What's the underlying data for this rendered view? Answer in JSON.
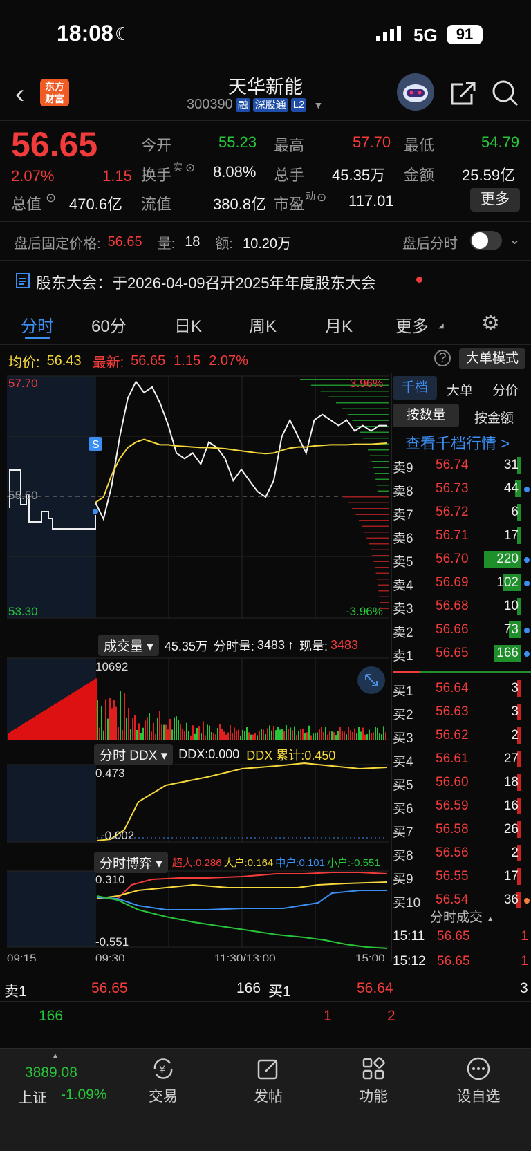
{
  "status_bar": {
    "time": "18:08",
    "network": "5G",
    "battery": "91"
  },
  "header": {
    "brand_line1": "东方",
    "brand_line2": "财富",
    "stock_name": "天华新能",
    "stock_code": "300390",
    "tags": [
      "融",
      "深股通",
      "L2"
    ]
  },
  "quote": {
    "price": "56.65",
    "change_pct": "2.07%",
    "change": "1.15",
    "open_label": "今开",
    "open": "55.23",
    "high_label": "最高",
    "high": "57.70",
    "low_label": "最低",
    "low": "54.79",
    "turnover_label": "换手",
    "turnover_sup": "实",
    "turnover": "8.08%",
    "volume_label": "总手",
    "volume": "45.35万",
    "amount_label": "金额",
    "amount": "25.59亿",
    "mcap_label": "总值",
    "mcap": "470.6亿",
    "float_label": "流值",
    "float": "380.8亿",
    "pe_label": "市盈",
    "pe_sup": "动",
    "pe": "117.01",
    "more_button": "更多"
  },
  "after_hours": {
    "label": "盘后固定价格:",
    "price": "56.65",
    "qty_label": "量:",
    "qty": "18",
    "amt_label": "额:",
    "amt": "10.20万",
    "toggle_label": "盘后分时"
  },
  "notice": {
    "text": "股东大会：于2026-04-09召开2025年年度股东大会"
  },
  "tabs": {
    "t1": "分时",
    "t2": "60分",
    "t3": "日K",
    "t4": "周K",
    "t5": "月K",
    "t6": "更多"
  },
  "info_line": {
    "avg_label": "均价:",
    "avg": "56.43",
    "latest_label": "最新:",
    "latest": "56.65",
    "change": "1.15",
    "pct": "2.07%",
    "mode_button": "大单模式"
  },
  "chart_data": {
    "type": "line",
    "title": "",
    "y_max_label": "57.70",
    "y_mid_label": "55.50",
    "y_min_label": "53.30",
    "pct_max_label": "3.96%",
    "pct_min_label": "-3.96%",
    "ylim": [
      53.3,
      57.7
    ],
    "prev_close": 55.5,
    "x_ticks": [
      "09:15",
      "09:30",
      "11:30/13:00",
      "15:00"
    ],
    "series": [
      {
        "values": [
          55.4,
          55.1,
          55.7,
          56.6,
          57.3,
          57.6,
          57.4,
          57.5,
          57.2,
          56.8,
          56.3,
          56.2,
          56.3,
          56.1,
          56.5,
          56.4,
          56.2,
          55.8,
          56.0,
          55.8,
          55.6,
          55.5,
          55.8,
          56.6,
          56.9,
          56.6,
          56.3,
          56.9,
          57.0,
          56.9,
          56.8,
          56.9,
          56.7,
          56.8,
          56.7,
          56.8,
          56.8
        ]
      },
      {
        "values": [
          55.4,
          55.5,
          55.9,
          56.2,
          56.4,
          56.5,
          56.55,
          56.5,
          56.45,
          56.45,
          56.43,
          56.42,
          56.41,
          56.4,
          56.4,
          56.39,
          56.38,
          56.36,
          56.34,
          56.32,
          56.3,
          56.29,
          56.3,
          56.35,
          56.39,
          56.41,
          56.41,
          56.43,
          56.44,
          56.45,
          56.45,
          56.45,
          56.46,
          56.46,
          56.46,
          56.47,
          56.48
        ]
      }
    ]
  },
  "volume_panel": {
    "label": "成交量",
    "total": "45.35万",
    "minute_label": "分时量:",
    "minute": "3483",
    "now_label": "现量:",
    "now": "3483",
    "max": "10692"
  },
  "ddx_panel": {
    "label": "分时 DDX",
    "ddx": "DDX:0.000",
    "ddx_cum": "DDX 累计:0.450",
    "max": "0.473",
    "min": "-0.002"
  },
  "game_panel": {
    "label": "分时博弈",
    "super": "超大:0.286",
    "big": "大户:0.164",
    "mid": "中户:0.101",
    "small": "小户:-0.551",
    "max": "0.310",
    "min": "-0.551"
  },
  "order_book": {
    "tab1": "千档",
    "tab2": "大单",
    "tab3": "分价",
    "sub1": "按数量",
    "sub2": "按金额",
    "view_link": "查看千档行情 >",
    "asks": [
      {
        "label": "卖9",
        "price": "56.74",
        "vol": "31",
        "ratio": 0.1,
        "dot": ""
      },
      {
        "label": "卖8",
        "price": "56.73",
        "vol": "44",
        "ratio": 0.14,
        "dot": "#3b8ff2"
      },
      {
        "label": "卖7",
        "price": "56.72",
        "vol": "6",
        "ratio": 0.02,
        "dot": ""
      },
      {
        "label": "卖6",
        "price": "56.71",
        "vol": "17",
        "ratio": 0.06,
        "dot": ""
      },
      {
        "label": "卖5",
        "price": "56.70",
        "vol": "220",
        "ratio": 0.85,
        "dot": "#3b8ff2"
      },
      {
        "label": "卖4",
        "price": "56.69",
        "vol": "102",
        "ratio": 0.4,
        "dot": "#3b8ff2"
      },
      {
        "label": "卖3",
        "price": "56.68",
        "vol": "10",
        "ratio": 0.03,
        "dot": ""
      },
      {
        "label": "卖2",
        "price": "56.66",
        "vol": "73",
        "ratio": 0.28,
        "dot": "#3b8ff2"
      },
      {
        "label": "卖1",
        "price": "56.65",
        "vol": "166",
        "ratio": 0.62,
        "dot": "#3b8ff2"
      }
    ],
    "bids": [
      {
        "label": "买1",
        "price": "56.64",
        "vol": "3",
        "ratio": 0.01,
        "dot": ""
      },
      {
        "label": "买2",
        "price": "56.63",
        "vol": "3",
        "ratio": 0.01,
        "dot": ""
      },
      {
        "label": "买3",
        "price": "56.62",
        "vol": "2",
        "ratio": 0.01,
        "dot": ""
      },
      {
        "label": "买4",
        "price": "56.61",
        "vol": "27",
        "ratio": 0.09,
        "dot": ""
      },
      {
        "label": "买5",
        "price": "56.60",
        "vol": "18",
        "ratio": 0.06,
        "dot": ""
      },
      {
        "label": "买6",
        "price": "56.59",
        "vol": "16",
        "ratio": 0.05,
        "dot": ""
      },
      {
        "label": "买7",
        "price": "56.58",
        "vol": "26",
        "ratio": 0.08,
        "dot": ""
      },
      {
        "label": "买8",
        "price": "56.56",
        "vol": "2",
        "ratio": 0.01,
        "dot": ""
      },
      {
        "label": "买9",
        "price": "56.55",
        "vol": "17",
        "ratio": 0.06,
        "dot": ""
      },
      {
        "label": "买10",
        "price": "56.54",
        "vol": "36",
        "ratio": 0.12,
        "dot": "#f5803c"
      }
    ],
    "trades_title": "分时成交",
    "trades": [
      {
        "time": "15:11",
        "price": "56.65",
        "vol": "1"
      },
      {
        "time": "15:12",
        "price": "56.65",
        "vol": "1"
      }
    ]
  },
  "level_bar": {
    "ask_label": "卖1",
    "ask_price": "56.65",
    "ask_vol": "166",
    "bid_label": "买1",
    "bid_price": "56.64",
    "bid_vol": "3",
    "queue_left": "166",
    "queue_right_1": "1",
    "queue_right_2": "2"
  },
  "bottom_nav": {
    "index_value": "3889.08",
    "index_name": "上证",
    "index_pct": "-1.09%",
    "trade": "交易",
    "post": "发帖",
    "func": "功能",
    "watch": "设自选"
  }
}
